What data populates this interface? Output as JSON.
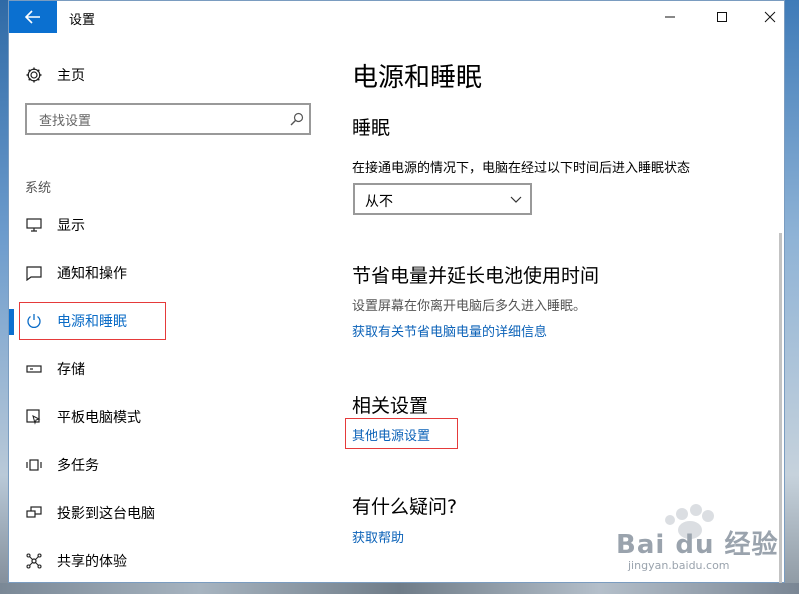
{
  "window": {
    "title": "设置"
  },
  "sidebar": {
    "home_label": "主页",
    "search_placeholder": "查找设置",
    "section_label": "系统",
    "items": [
      {
        "label": "显示",
        "icon": "display-icon"
      },
      {
        "label": "通知和操作",
        "icon": "notification-icon"
      },
      {
        "label": "电源和睡眠",
        "icon": "power-icon",
        "active": true
      },
      {
        "label": "存储",
        "icon": "storage-icon"
      },
      {
        "label": "平板电脑模式",
        "icon": "tablet-mode-icon"
      },
      {
        "label": "多任务",
        "icon": "multitask-icon"
      },
      {
        "label": "投影到这台电脑",
        "icon": "project-icon"
      },
      {
        "label": "共享的体验",
        "icon": "shared-experience-icon"
      }
    ]
  },
  "main": {
    "title": "电源和睡眠",
    "sleep": {
      "heading": "睡眠",
      "description": "在接通电源的情况下，电脑在经过以下时间后进入睡眠状态",
      "selected": "从不"
    },
    "save_power": {
      "heading": "节省电量并延长电池使用时间",
      "description": "设置屏幕在你离开电脑后多久进入睡眠。",
      "link": "获取有关节省电脑电量的详细信息"
    },
    "related": {
      "heading": "相关设置",
      "link": "其他电源设置"
    },
    "help": {
      "heading": "有什么疑问?",
      "link": "获取帮助"
    }
  },
  "watermark": {
    "text": "Bai du 经验",
    "url": "jingyan.baidu.com"
  },
  "colors": {
    "accent": "#0b70d0",
    "link": "#0b62b8",
    "highlight_box": "#e53a3a"
  }
}
